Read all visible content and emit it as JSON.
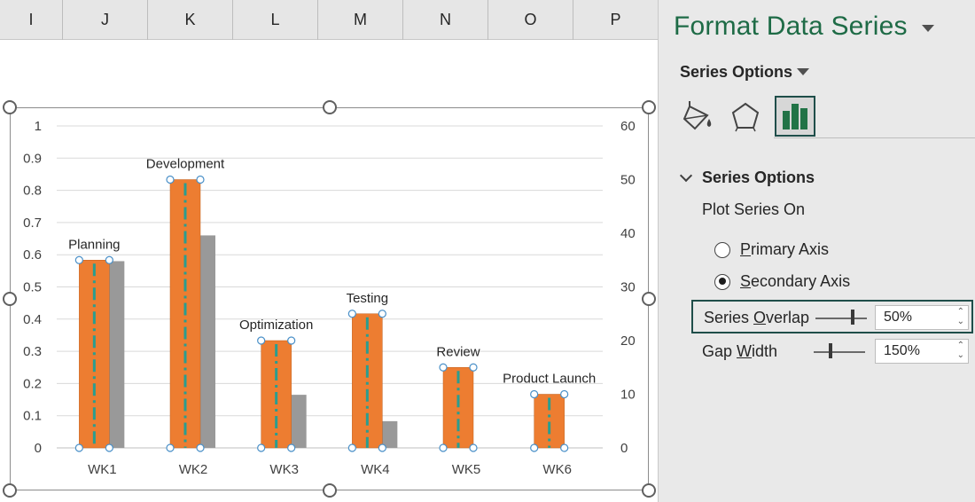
{
  "sheet": {
    "columns": [
      "I",
      "J",
      "K",
      "L",
      "M",
      "N",
      "O",
      "P"
    ]
  },
  "chart_data": {
    "type": "bar",
    "categories": [
      "WK1",
      "WK2",
      "WK3",
      "WK4",
      "WK5",
      "WK6"
    ],
    "primary_axis": {
      "ticks": [
        "0",
        "0.1",
        "0.2",
        "0.3",
        "0.4",
        "0.5",
        "0.6",
        "0.7",
        "0.8",
        "0.9",
        "1"
      ],
      "ylim": [
        0,
        1
      ]
    },
    "secondary_axis": {
      "ticks": [
        "0",
        "10",
        "20",
        "30",
        "40",
        "50",
        "60"
      ],
      "ylim": [
        0,
        60
      ]
    },
    "series": [
      {
        "axis": "primary",
        "color": "#999999",
        "values": [
          0.58,
          0.66,
          0.165,
          0.083,
          0,
          0
        ]
      },
      {
        "axis": "secondary",
        "color": "#ed7d31",
        "selected": true,
        "values": [
          35,
          50,
          20,
          25,
          15,
          10
        ],
        "data_labels": [
          "Planning",
          "Development",
          "Optimization",
          "Testing",
          "Review",
          "Product Launch"
        ]
      }
    ],
    "dash_color": "#2a9d8f",
    "grid": true
  },
  "pane": {
    "title": "Format Data Series",
    "dropdown_label": "Series Options",
    "icons": [
      "paint-bucket-icon",
      "pentagon-icon",
      "bar-chart-icon"
    ],
    "section_title": "Series Options",
    "plot_series_on": "Plot Series On",
    "primary_axis": {
      "pre": "",
      "key": "P",
      "post": "rimary Axis",
      "checked": false
    },
    "secondary_axis": {
      "pre": "",
      "key": "S",
      "post": "econdary Axis",
      "checked": true
    },
    "series_overlap": {
      "pre": "Series ",
      "key": "O",
      "post": "verlap",
      "value": "50%"
    },
    "gap_width": {
      "pre": "Gap ",
      "key": "W",
      "post": "idth",
      "value": "150%"
    }
  }
}
